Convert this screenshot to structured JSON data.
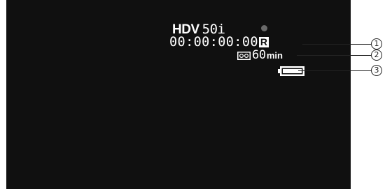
{
  "osd": {
    "format_label": "HDV",
    "frame_rate": "50i",
    "timecode": "00:00:00:00",
    "remote_indicator": "R",
    "tape_remaining_value": "60",
    "tape_remaining_unit": "min"
  },
  "callouts": [
    "1",
    "2",
    "3"
  ],
  "icons": {
    "recording_indicator": "record-dot-icon",
    "tape": "cassette-icon",
    "battery": "battery-icon"
  },
  "colors": {
    "screen_background": "#101010",
    "osd_text": "#ffffff",
    "record_dot": "#6a6a6a"
  }
}
